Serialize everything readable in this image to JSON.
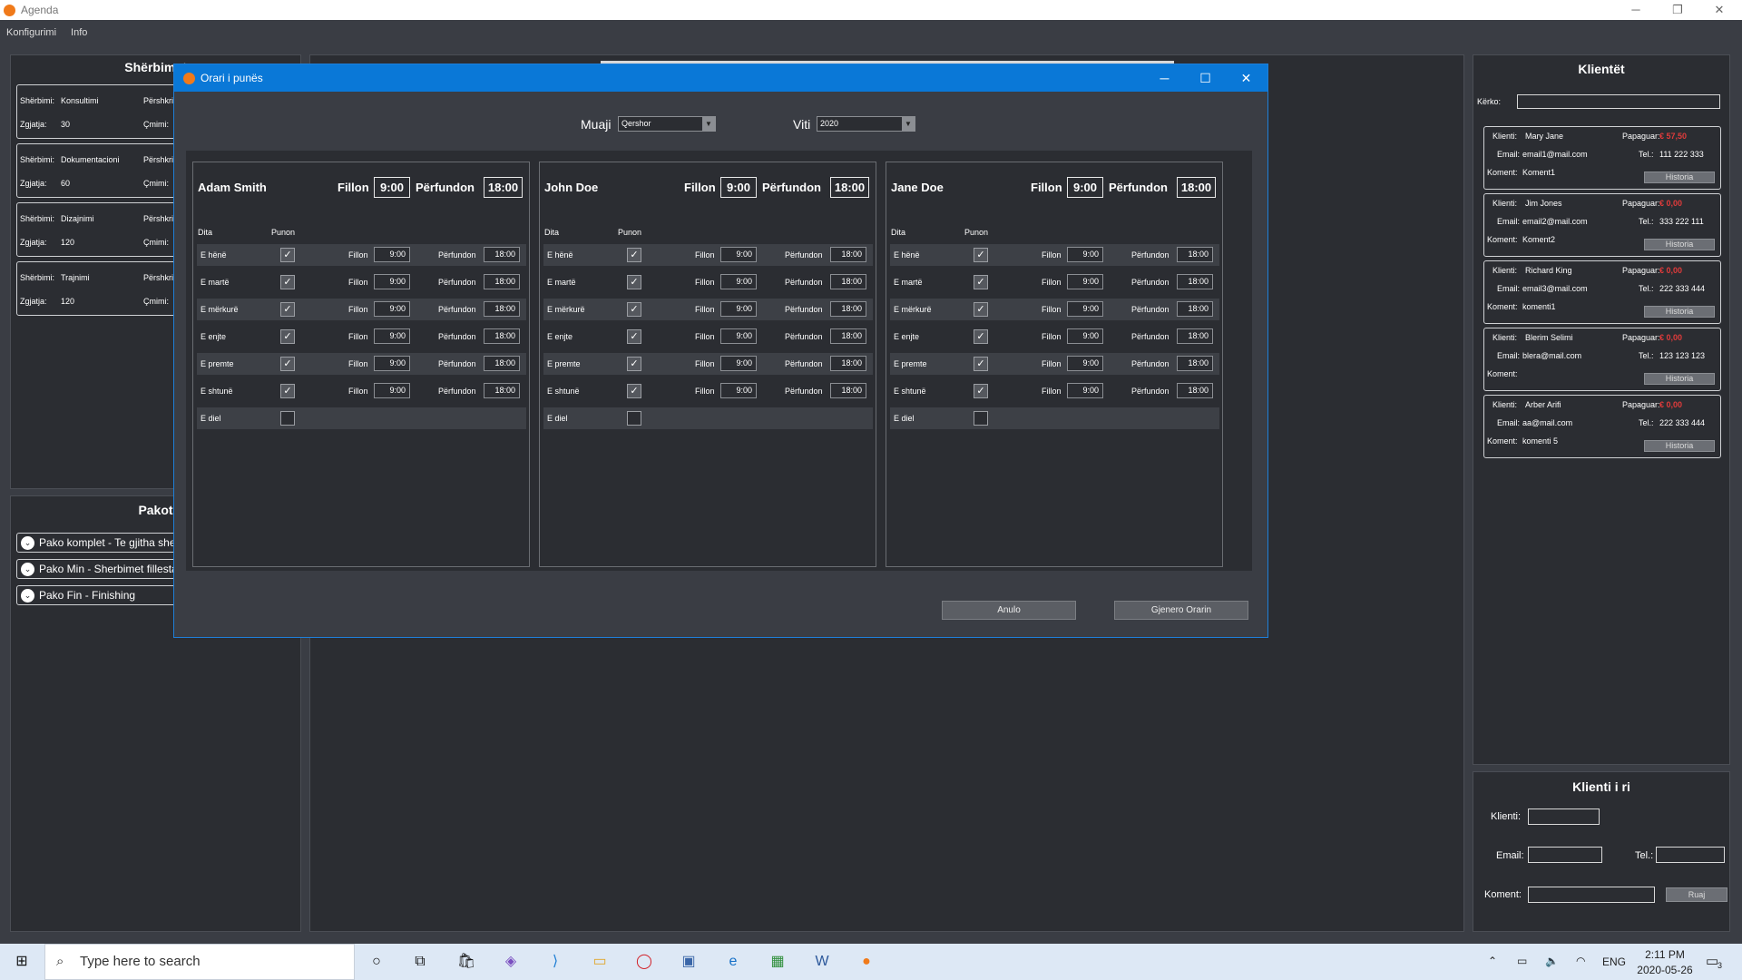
{
  "app": {
    "title": "Agenda"
  },
  "menu": [
    "Konfigurimi",
    "Info"
  ],
  "services": {
    "title": "Shërbimet",
    "items": [
      {
        "service_label": "Shërbimi:",
        "name": "Konsultimi",
        "desc_label": "Përshkrimi:",
        "duration_label": "Zgjatja:",
        "duration": "30",
        "price_label": "Çmimi:"
      },
      {
        "service_label": "Shërbimi:",
        "name": "Dokumentacioni",
        "desc_label": "Përshkrimi:",
        "duration_label": "Zgjatja:",
        "duration": "60",
        "price_label": "Çmimi:"
      },
      {
        "service_label": "Shërbimi:",
        "name": "Dizajnimi",
        "desc_label": "Përshkrimi:",
        "duration_label": "Zgjatja:",
        "duration": "120",
        "price_label": "Çmimi:"
      },
      {
        "service_label": "Shërbimi:",
        "name": "Trajnimi",
        "desc_label": "Përshkrimi:",
        "duration_label": "Zgjatja:",
        "duration": "120",
        "price_label": "Çmimi:"
      }
    ]
  },
  "packages": {
    "title": "Pakot",
    "items": [
      "Pako komplet - Te gjitha sherbimet",
      "Pako Min - Sherbimet fillestare",
      "Pako Fin - Finishing"
    ]
  },
  "clients": {
    "title": "Klientët",
    "search_label": "Kërko:",
    "search_value": "",
    "items": [
      {
        "client_label": "Klienti:",
        "name": "Mary Jane",
        "paid_label": "Papaguar:",
        "paid": "€ 57,50",
        "email_label": "Email:",
        "email": "email1@mail.com",
        "tel_label": "Tel.:",
        "tel": "111 222 333",
        "comment_label": "Koment:",
        "comment": "Koment1",
        "history": "Historia"
      },
      {
        "client_label": "Klienti:",
        "name": "Jim Jones",
        "paid_label": "Papaguar:",
        "paid": "€ 0,00",
        "email_label": "Email:",
        "email": "email2@mail.com",
        "tel_label": "Tel.:",
        "tel": "333 222 111",
        "comment_label": "Koment:",
        "comment": "Koment2",
        "history": "Historia"
      },
      {
        "client_label": "Klienti:",
        "name": "Richard King",
        "paid_label": "Papaguar:",
        "paid": "€ 0,00",
        "email_label": "Email:",
        "email": "email3@mail.com",
        "tel_label": "Tel.:",
        "tel": "222 333 444",
        "comment_label": "Koment:",
        "comment": "komenti1",
        "history": "Historia"
      },
      {
        "client_label": "Klienti:",
        "name": "Blerim Selimi",
        "paid_label": "Papaguar:",
        "paid": "€ 0,00",
        "email_label": "Email:",
        "email": "blera@mail.com",
        "tel_label": "Tel.:",
        "tel": "123 123 123",
        "comment_label": "Koment:",
        "comment": "",
        "history": "Historia"
      },
      {
        "client_label": "Klienti:",
        "name": "Arber Arifi",
        "paid_label": "Papaguar:",
        "paid": "€ 0,00",
        "email_label": "Email:",
        "email": "aa@mail.com",
        "tel_label": "Tel.:",
        "tel": "222 333 444",
        "comment_label": "Koment:",
        "comment": "komenti 5",
        "history": "Historia"
      }
    ]
  },
  "new_client": {
    "title": "Klienti i ri",
    "client_label": "Klienti:",
    "email_label": "Email:",
    "tel_label": "Tel.:",
    "comment_label": "Koment:",
    "save": "Ruaj"
  },
  "dialog": {
    "title": "Orari i punës",
    "month_label": "Muaji",
    "month": "Qershor",
    "year_label": "Viti",
    "year": "2020",
    "cancel": "Anulo",
    "generate": "Gjenero Orarin",
    "col_day": "Dita",
    "col_work": "Punon",
    "start_label": "Fillon",
    "end_label": "Përfundon",
    "employees": [
      {
        "name": "Adam Smith",
        "start": "9:00",
        "end": "18:00"
      },
      {
        "name": "John Doe",
        "start": "9:00",
        "end": "18:00"
      },
      {
        "name": "Jane Doe",
        "start": "9:00",
        "end": "18:00"
      }
    ],
    "days": [
      {
        "name": "E hënë",
        "works": true,
        "start": "9:00",
        "end": "18:00"
      },
      {
        "name": "E martë",
        "works": true,
        "start": "9:00",
        "end": "18:00"
      },
      {
        "name": "E mërkurë",
        "works": true,
        "start": "9:00",
        "end": "18:00"
      },
      {
        "name": "E enjte",
        "works": true,
        "start": "9:00",
        "end": "18:00"
      },
      {
        "name": "E premte",
        "works": true,
        "start": "9:00",
        "end": "18:00"
      },
      {
        "name": "E shtunë",
        "works": true,
        "start": "9:00",
        "end": "18:00"
      },
      {
        "name": "E diel",
        "works": false,
        "start": "",
        "end": ""
      }
    ]
  },
  "taskbar": {
    "search_placeholder": "Type here to search",
    "lang": "ENG",
    "time": "2:11 PM",
    "date": "2020-05-26",
    "notifications": "3"
  }
}
